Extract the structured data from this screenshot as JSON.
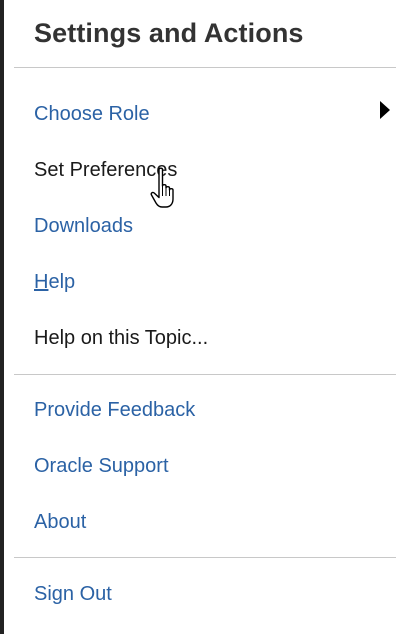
{
  "menu": {
    "title": "Settings and Actions",
    "items": [
      {
        "label": "Choose Role",
        "has_submenu": true
      },
      {
        "label": "Set Preferences",
        "hovered": true
      },
      {
        "label": "Downloads"
      },
      {
        "label": "Help",
        "accesskey": "H"
      },
      {
        "label": "Help on this Topic..."
      },
      {
        "label": "Provide Feedback"
      },
      {
        "label": "Oracle Support"
      },
      {
        "label": "About"
      },
      {
        "label": "Sign Out"
      }
    ]
  },
  "colors": {
    "link": "#2b62a5",
    "text": "#1a1a1a",
    "title": "#333333",
    "divider": "#c8c8c8"
  },
  "icons": {
    "submenu": "triangle-right-icon",
    "cursor": "hand-pointer-icon"
  }
}
